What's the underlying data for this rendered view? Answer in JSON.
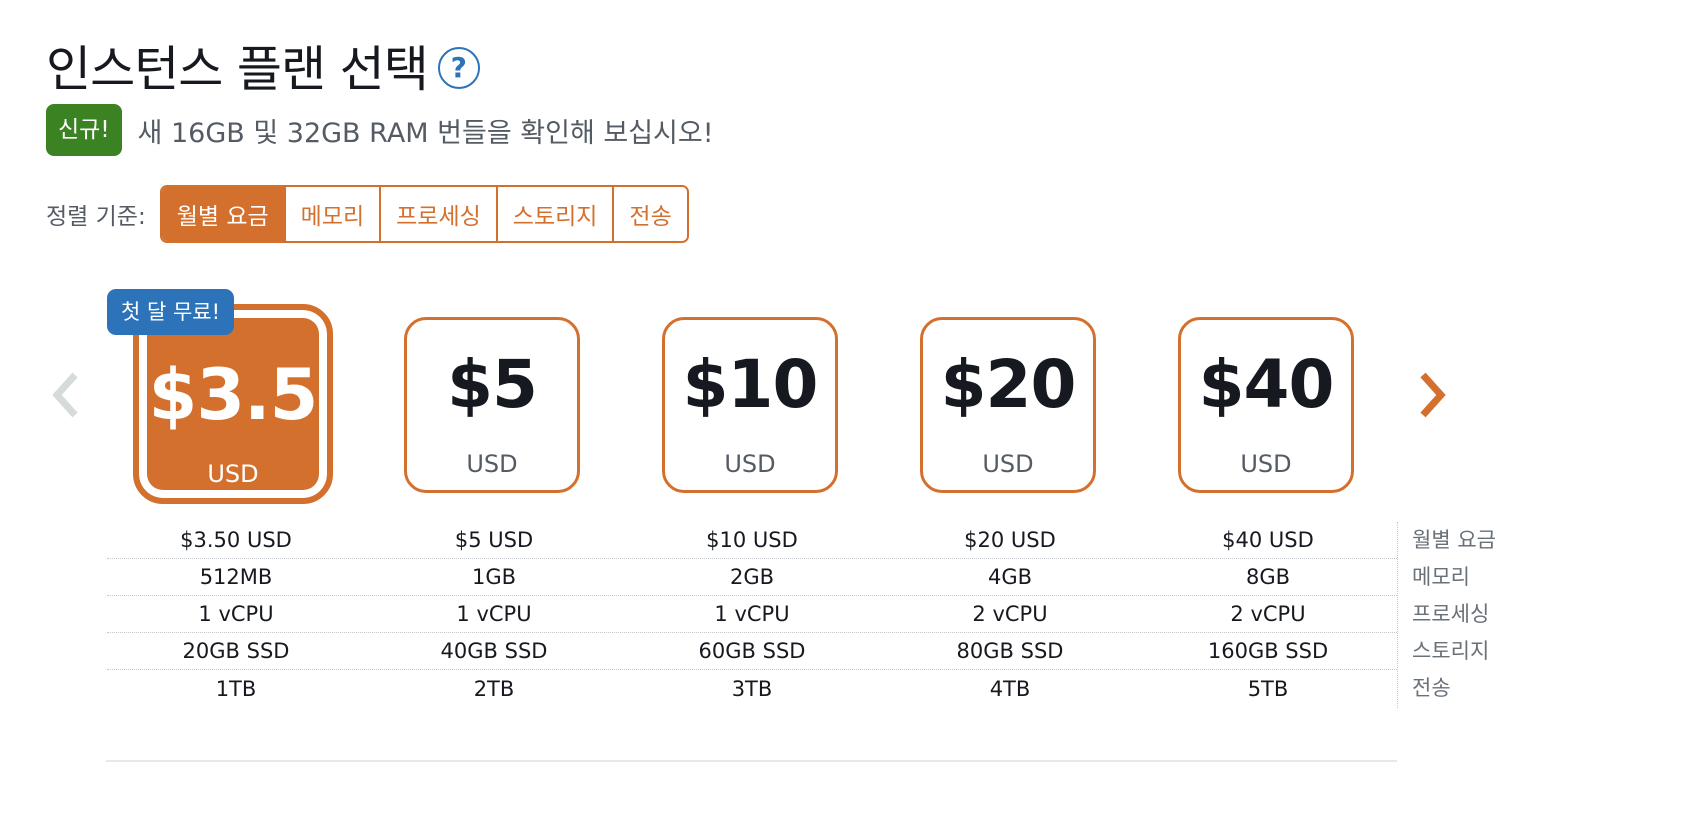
{
  "header": {
    "title": "인스턴스 플랜 선택",
    "help_icon_label": "?"
  },
  "announcement": {
    "badge": "신규!",
    "text": "새 16GB 및 32GB RAM 번들을 확인해 보십시오!"
  },
  "sort": {
    "label": "정렬 기준:",
    "options": [
      "월별 요금",
      "메모리",
      "프로세싱",
      "스토리지",
      "전송"
    ],
    "selected_index": 0
  },
  "carousel": {
    "prev_icon": "chevron-left-icon",
    "next_icon": "chevron-right-icon",
    "prev_enabled": false,
    "next_enabled": true
  },
  "promo_badge": "첫 달 무료!",
  "plans": [
    {
      "price": "$3.5",
      "currency": "USD",
      "monthly": "$3.50 USD",
      "memory": "512MB",
      "processing": "1 vCPU",
      "storage": "20GB SSD",
      "transfer": "1TB",
      "selected": true
    },
    {
      "price": "$5",
      "currency": "USD",
      "monthly": "$5 USD",
      "memory": "1GB",
      "processing": "1 vCPU",
      "storage": "40GB SSD",
      "transfer": "2TB",
      "selected": false
    },
    {
      "price": "$10",
      "currency": "USD",
      "monthly": "$10 USD",
      "memory": "2GB",
      "processing": "1 vCPU",
      "storage": "60GB SSD",
      "transfer": "3TB",
      "selected": false
    },
    {
      "price": "$20",
      "currency": "USD",
      "monthly": "$20 USD",
      "memory": "4GB",
      "processing": "2 vCPU",
      "storage": "80GB SSD",
      "transfer": "4TB",
      "selected": false
    },
    {
      "price": "$40",
      "currency": "USD",
      "monthly": "$40 USD",
      "memory": "8GB",
      "processing": "2 vCPU",
      "storage": "160GB SSD",
      "transfer": "5TB",
      "selected": false
    }
  ],
  "row_labels": [
    "월별 요금",
    "메모리",
    "프로세싱",
    "스토리지",
    "전송"
  ],
  "colors": {
    "accent": "#d4702e",
    "promo": "#2c73b9",
    "new_badge": "#3b8223",
    "text_primary": "#16191f",
    "text_secondary": "#545b64",
    "disabled_arrow": "#d5dbdb"
  }
}
